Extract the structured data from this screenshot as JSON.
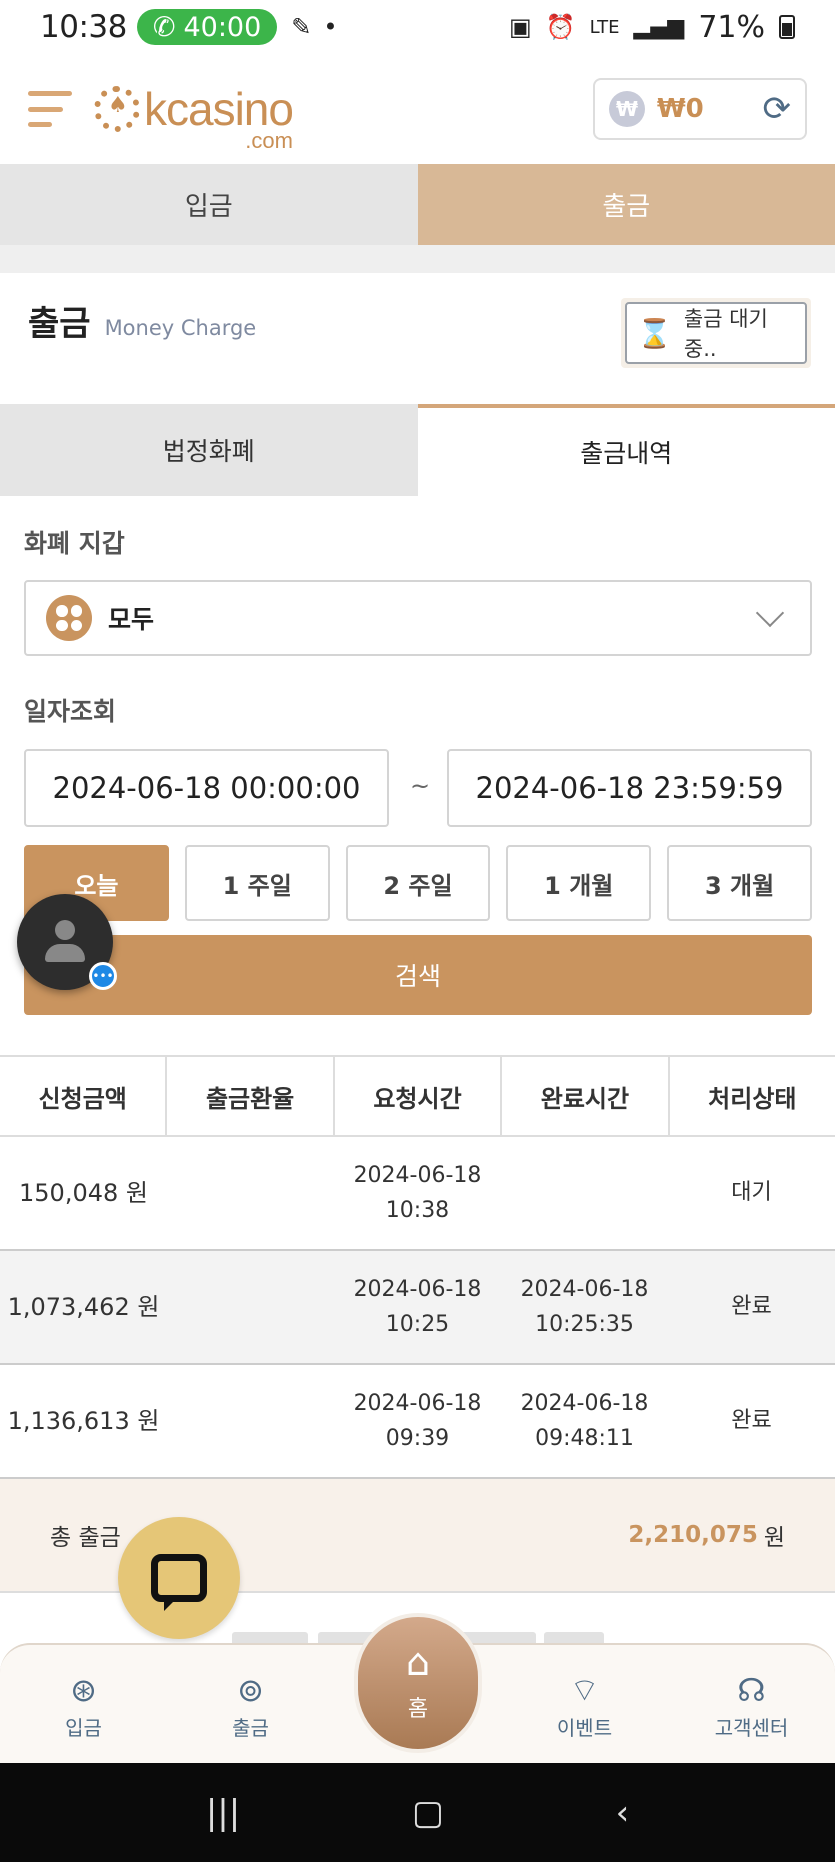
{
  "status_bar": {
    "time": "10:38",
    "call_timer": "40:00",
    "battery": "71%",
    "network": "LTE"
  },
  "header": {
    "logo_main": "kcasino",
    "logo_sub": ".com",
    "balance": "₩0",
    "currency_icon": "₩"
  },
  "main_tabs": {
    "deposit": "입금",
    "withdraw": "출금"
  },
  "section": {
    "title": "출금",
    "subtitle": "Money Charge",
    "pending_button": "출금 대기 중.."
  },
  "sub_tabs": {
    "fiat": "법정화폐",
    "history": "출금내역"
  },
  "filters": {
    "wallet_label": "화폐 지갑",
    "wallet_value": "모두",
    "date_label": "일자조회",
    "date_from": "2024-06-18 00:00:00",
    "date_separator": "~",
    "date_to": "2024-06-18 23:59:59",
    "periods": [
      "오늘",
      "1 주일",
      "2 주일",
      "1 개월",
      "3 개월"
    ],
    "active_period": "오늘",
    "search_button": "검색"
  },
  "table": {
    "headers": [
      "신청금액",
      "출금환율",
      "요청시간",
      "완료시간",
      "처리상태"
    ],
    "rows": [
      {
        "amount": "150,048 원",
        "rate": "",
        "request_date": "2024-06-18",
        "request_time": "10:38",
        "complete_date": "",
        "complete_time": "",
        "status": "대기"
      },
      {
        "amount": "1,073,462 원",
        "rate": "",
        "request_date": "2024-06-18",
        "request_time": "10:25",
        "complete_date": "2024-06-18",
        "complete_time": "10:25:35",
        "status": "완료"
      },
      {
        "amount": "1,136,613 원",
        "rate": "",
        "request_date": "2024-06-18",
        "request_time": "09:39",
        "complete_date": "2024-06-18",
        "complete_time": "09:48:11",
        "status": "완료"
      }
    ],
    "total_label": "총 출금",
    "total_value": "2,210,075",
    "total_unit": "원"
  },
  "bottom_nav": {
    "deposit": "입금",
    "withdraw": "출금",
    "home": "홈",
    "event": "이벤트",
    "support": "고객센터"
  },
  "colors": {
    "accent": "#c9945f",
    "tab_active": "#d8b896",
    "status_done": "#3cb54a",
    "icon_blue": "#4f6b85"
  }
}
